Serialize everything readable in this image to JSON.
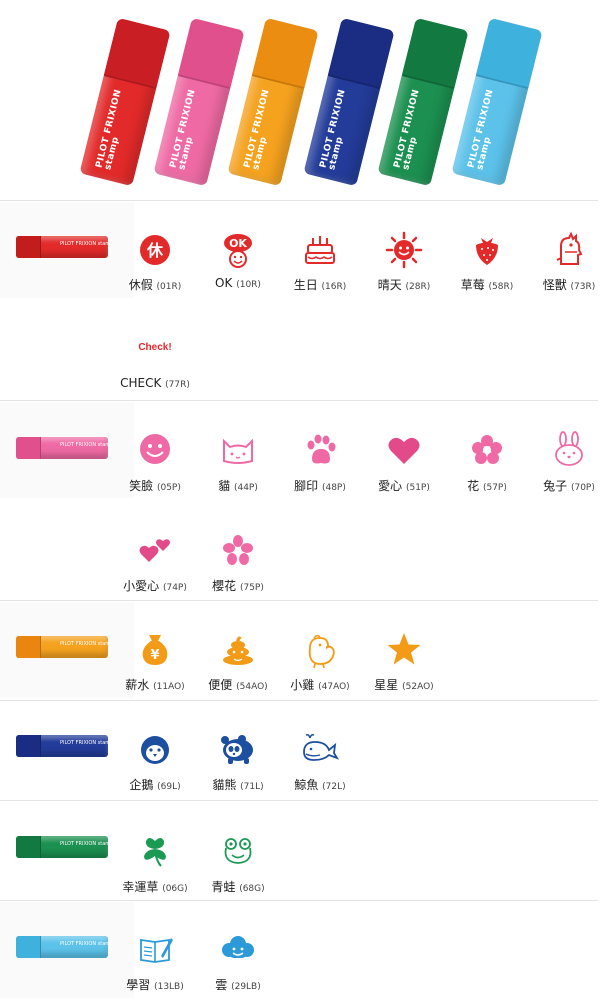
{
  "hero": {
    "brand_text": "PILOT FRIXION stamp",
    "pens": [
      {
        "color": "#e32a2a",
        "cap": "#c91f24"
      },
      {
        "color": "#ef6aa4",
        "cap": "#e0508d"
      },
      {
        "color": "#f5a21f",
        "cap": "#ea8d10"
      },
      {
        "color": "#233c9a",
        "cap": "#1a2d82"
      },
      {
        "color": "#1c9050",
        "cap": "#127a41"
      },
      {
        "color": "#5cc2ea",
        "cap": "#3fb1dd"
      }
    ]
  },
  "sections": [
    {
      "name": "red",
      "color": "#e32a2a",
      "cap": "#c21c1c",
      "items": [
        {
          "label": "休假",
          "code": "(01R)",
          "icon": "rest-icon"
        },
        {
          "label": "OK",
          "code": "(10R)",
          "icon": "ok-icon"
        },
        {
          "label": "生日",
          "code": "(16R)",
          "icon": "cake-icon"
        },
        {
          "label": "晴天",
          "code": "(28R)",
          "icon": "sun-icon"
        },
        {
          "label": "草莓",
          "code": "(58R)",
          "icon": "strawberry-icon"
        },
        {
          "label": "怪獸",
          "code": "(73R)",
          "icon": "monster-icon"
        },
        {
          "label": "CHECK",
          "code": "(77R)",
          "icon": "check-icon",
          "glyph": "Check!"
        }
      ]
    },
    {
      "name": "pink",
      "color": "#ef6aa4",
      "cap": "#e0508d",
      "items": [
        {
          "label": "笑臉",
          "code": "(05P)",
          "icon": "smile-icon"
        },
        {
          "label": "貓",
          "code": "(44P)",
          "icon": "cat-icon"
        },
        {
          "label": "腳印",
          "code": "(48P)",
          "icon": "paw-icon"
        },
        {
          "label": "愛心",
          "code": "(51P)",
          "icon": "heart-icon"
        },
        {
          "label": "花",
          "code": "(57P)",
          "icon": "flower-icon"
        },
        {
          "label": "兔子",
          "code": "(70P)",
          "icon": "rabbit-icon"
        },
        {
          "label": "小愛心",
          "code": "(74P)",
          "icon": "small-hearts-icon"
        },
        {
          "label": "櫻花",
          "code": "(75P)",
          "icon": "sakura-icon"
        }
      ]
    },
    {
      "name": "orange",
      "color": "#f5a21f",
      "cap": "#ea8510",
      "items": [
        {
          "label": "薪水",
          "code": "(11AO)",
          "icon": "money-bag-icon"
        },
        {
          "label": "便便",
          "code": "(54AO)",
          "icon": "poop-icon"
        },
        {
          "label": "小雞",
          "code": "(47AO)",
          "icon": "chick-icon"
        },
        {
          "label": "星星",
          "code": "(52AO)",
          "icon": "star-icon"
        }
      ]
    },
    {
      "name": "blue",
      "color": "#233c9a",
      "cap": "#1a2d82",
      "items": [
        {
          "label": "企鵝",
          "code": "(69L)",
          "icon": "penguin-icon"
        },
        {
          "label": "貓熊",
          "code": "(71L)",
          "icon": "panda-icon"
        },
        {
          "label": "鯨魚",
          "code": "(72L)",
          "icon": "whale-icon"
        }
      ]
    },
    {
      "name": "green",
      "color": "#1c9050",
      "cap": "#127a41",
      "items": [
        {
          "label": "幸運草",
          "code": "(06G)",
          "icon": "clover-icon"
        },
        {
          "label": "青蛙",
          "code": "(68G)",
          "icon": "frog-icon"
        }
      ]
    },
    {
      "name": "light-blue",
      "color": "#5cc2ea",
      "cap": "#3fb1dd",
      "items": [
        {
          "label": "學習",
          "code": "(13LB)",
          "icon": "study-icon"
        },
        {
          "label": "雲",
          "code": "(29LB)",
          "icon": "cloud-icon"
        }
      ]
    }
  ]
}
